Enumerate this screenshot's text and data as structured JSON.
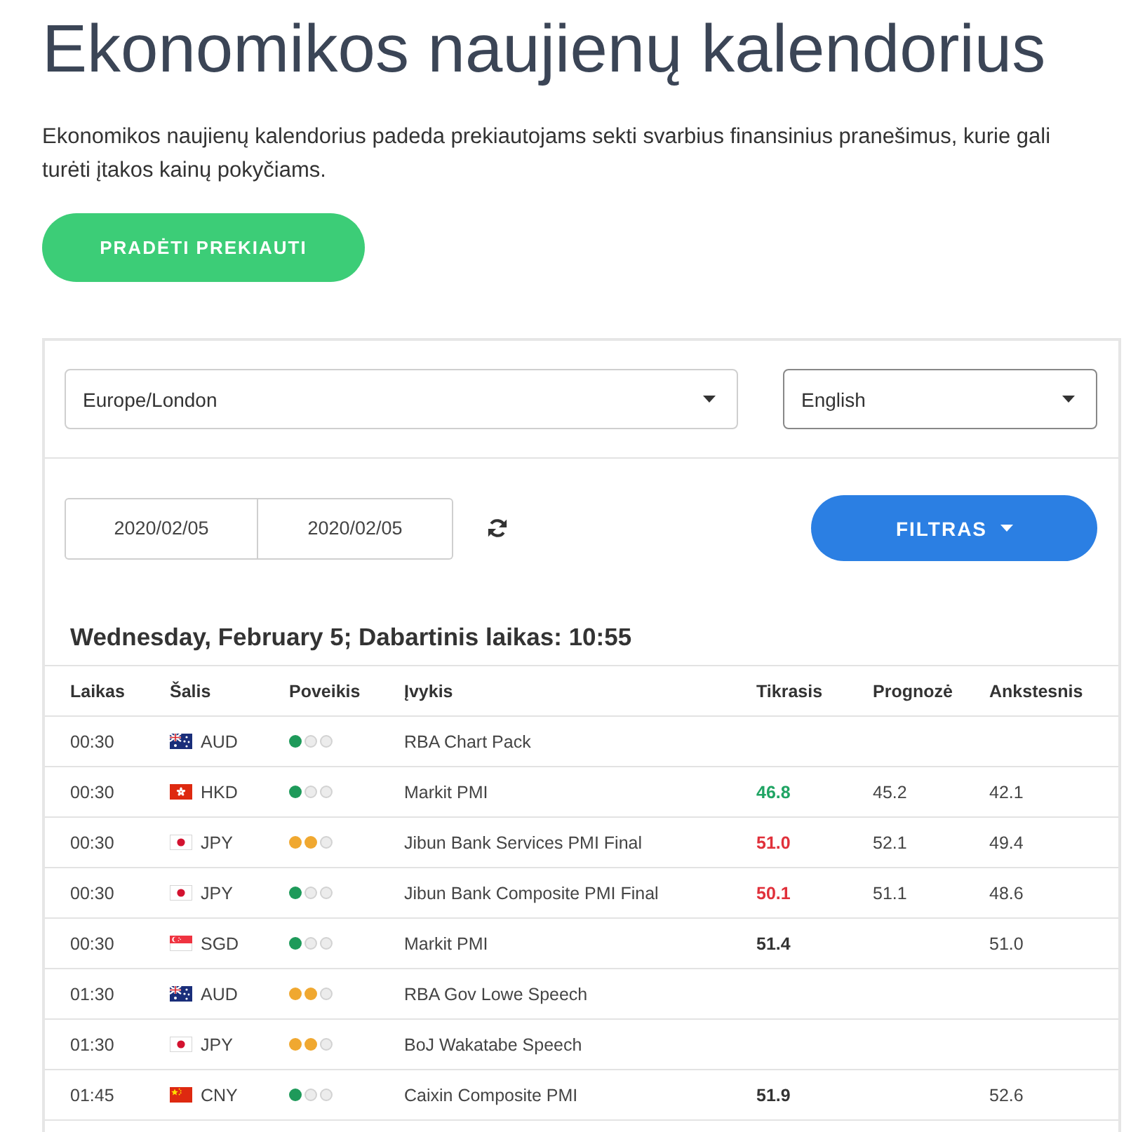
{
  "title": "Ekonomikos naujienų kalendorius",
  "intro": "Ekonomikos naujienų kalendorius padeda prekiautojams sekti svarbius finansinius pranešimus, kurie gali turėti įtakos kainų pokyčiams.",
  "cta_button": "PRADĖTI PREKIAUTI",
  "calendar": {
    "timezone_select": {
      "value": "Europe/London",
      "focused": false
    },
    "language_select": {
      "value": "English",
      "focused": true
    },
    "date_from": "2020/02/05",
    "date_to": "2020/02/05",
    "filter_button": "FILTRAS",
    "day_heading": "Wednesday, February 5; Dabartinis laikas: 10:55",
    "columns": [
      "Laikas",
      "Šalis",
      "Poveikis",
      "Įvykis",
      "Tikrasis",
      "Prognozė",
      "Ankstesnis"
    ],
    "rows": [
      {
        "time": "00:30",
        "flag": {
          "kind": "australia"
        },
        "currency": "AUD",
        "impact": {
          "stars": 1,
          "color": "#1e9a5a"
        },
        "event": "RBA Chart Pack"
      },
      {
        "time": "00:30",
        "flag": {
          "kind": "hongkong"
        },
        "currency": "HKD",
        "impact": {
          "stars": 1,
          "color": "#1e9a5a"
        },
        "event": "Markit PMI",
        "actual": {
          "value": "46.8",
          "color": "#1fa463"
        },
        "forecast": "45.2",
        "previous": "42.1"
      },
      {
        "time": "00:30",
        "flag": {
          "kind": "japan"
        },
        "currency": "JPY",
        "impact": {
          "stars": 2,
          "color": "#f0a830"
        },
        "event": "Jibun Bank Services PMI Final",
        "actual": {
          "value": "51.0",
          "color": "#e0303a"
        },
        "forecast": "52.1",
        "previous": "49.4"
      },
      {
        "time": "00:30",
        "flag": {
          "kind": "japan"
        },
        "currency": "JPY",
        "impact": {
          "stars": 1,
          "color": "#1e9a5a"
        },
        "event": "Jibun Bank Composite PMI Final",
        "actual": {
          "value": "50.1",
          "color": "#e0303a"
        },
        "forecast": "51.1",
        "previous": "48.6"
      },
      {
        "time": "00:30",
        "flag": {
          "kind": "singapore"
        },
        "currency": "SGD",
        "impact": {
          "stars": 1,
          "color": "#1e9a5a"
        },
        "event": "Markit PMI",
        "actual": {
          "value": "51.4",
          "color": "#333333"
        },
        "previous": "51.0"
      },
      {
        "time": "01:30",
        "flag": {
          "kind": "australia"
        },
        "currency": "AUD",
        "impact": {
          "stars": 2,
          "color": "#f0a830"
        },
        "event": "RBA Gov Lowe Speech"
      },
      {
        "time": "01:30",
        "flag": {
          "kind": "japan"
        },
        "currency": "JPY",
        "impact": {
          "stars": 2,
          "color": "#f0a830"
        },
        "event": "BoJ Wakatabe Speech"
      },
      {
        "time": "01:45",
        "flag": {
          "kind": "china"
        },
        "currency": "CNY",
        "impact": {
          "stars": 1,
          "color": "#1e9a5a"
        },
        "event": "Caixin Composite PMI",
        "actual": {
          "value": "51.9",
          "color": "#333333"
        },
        "previous": "52.6"
      }
    ]
  }
}
